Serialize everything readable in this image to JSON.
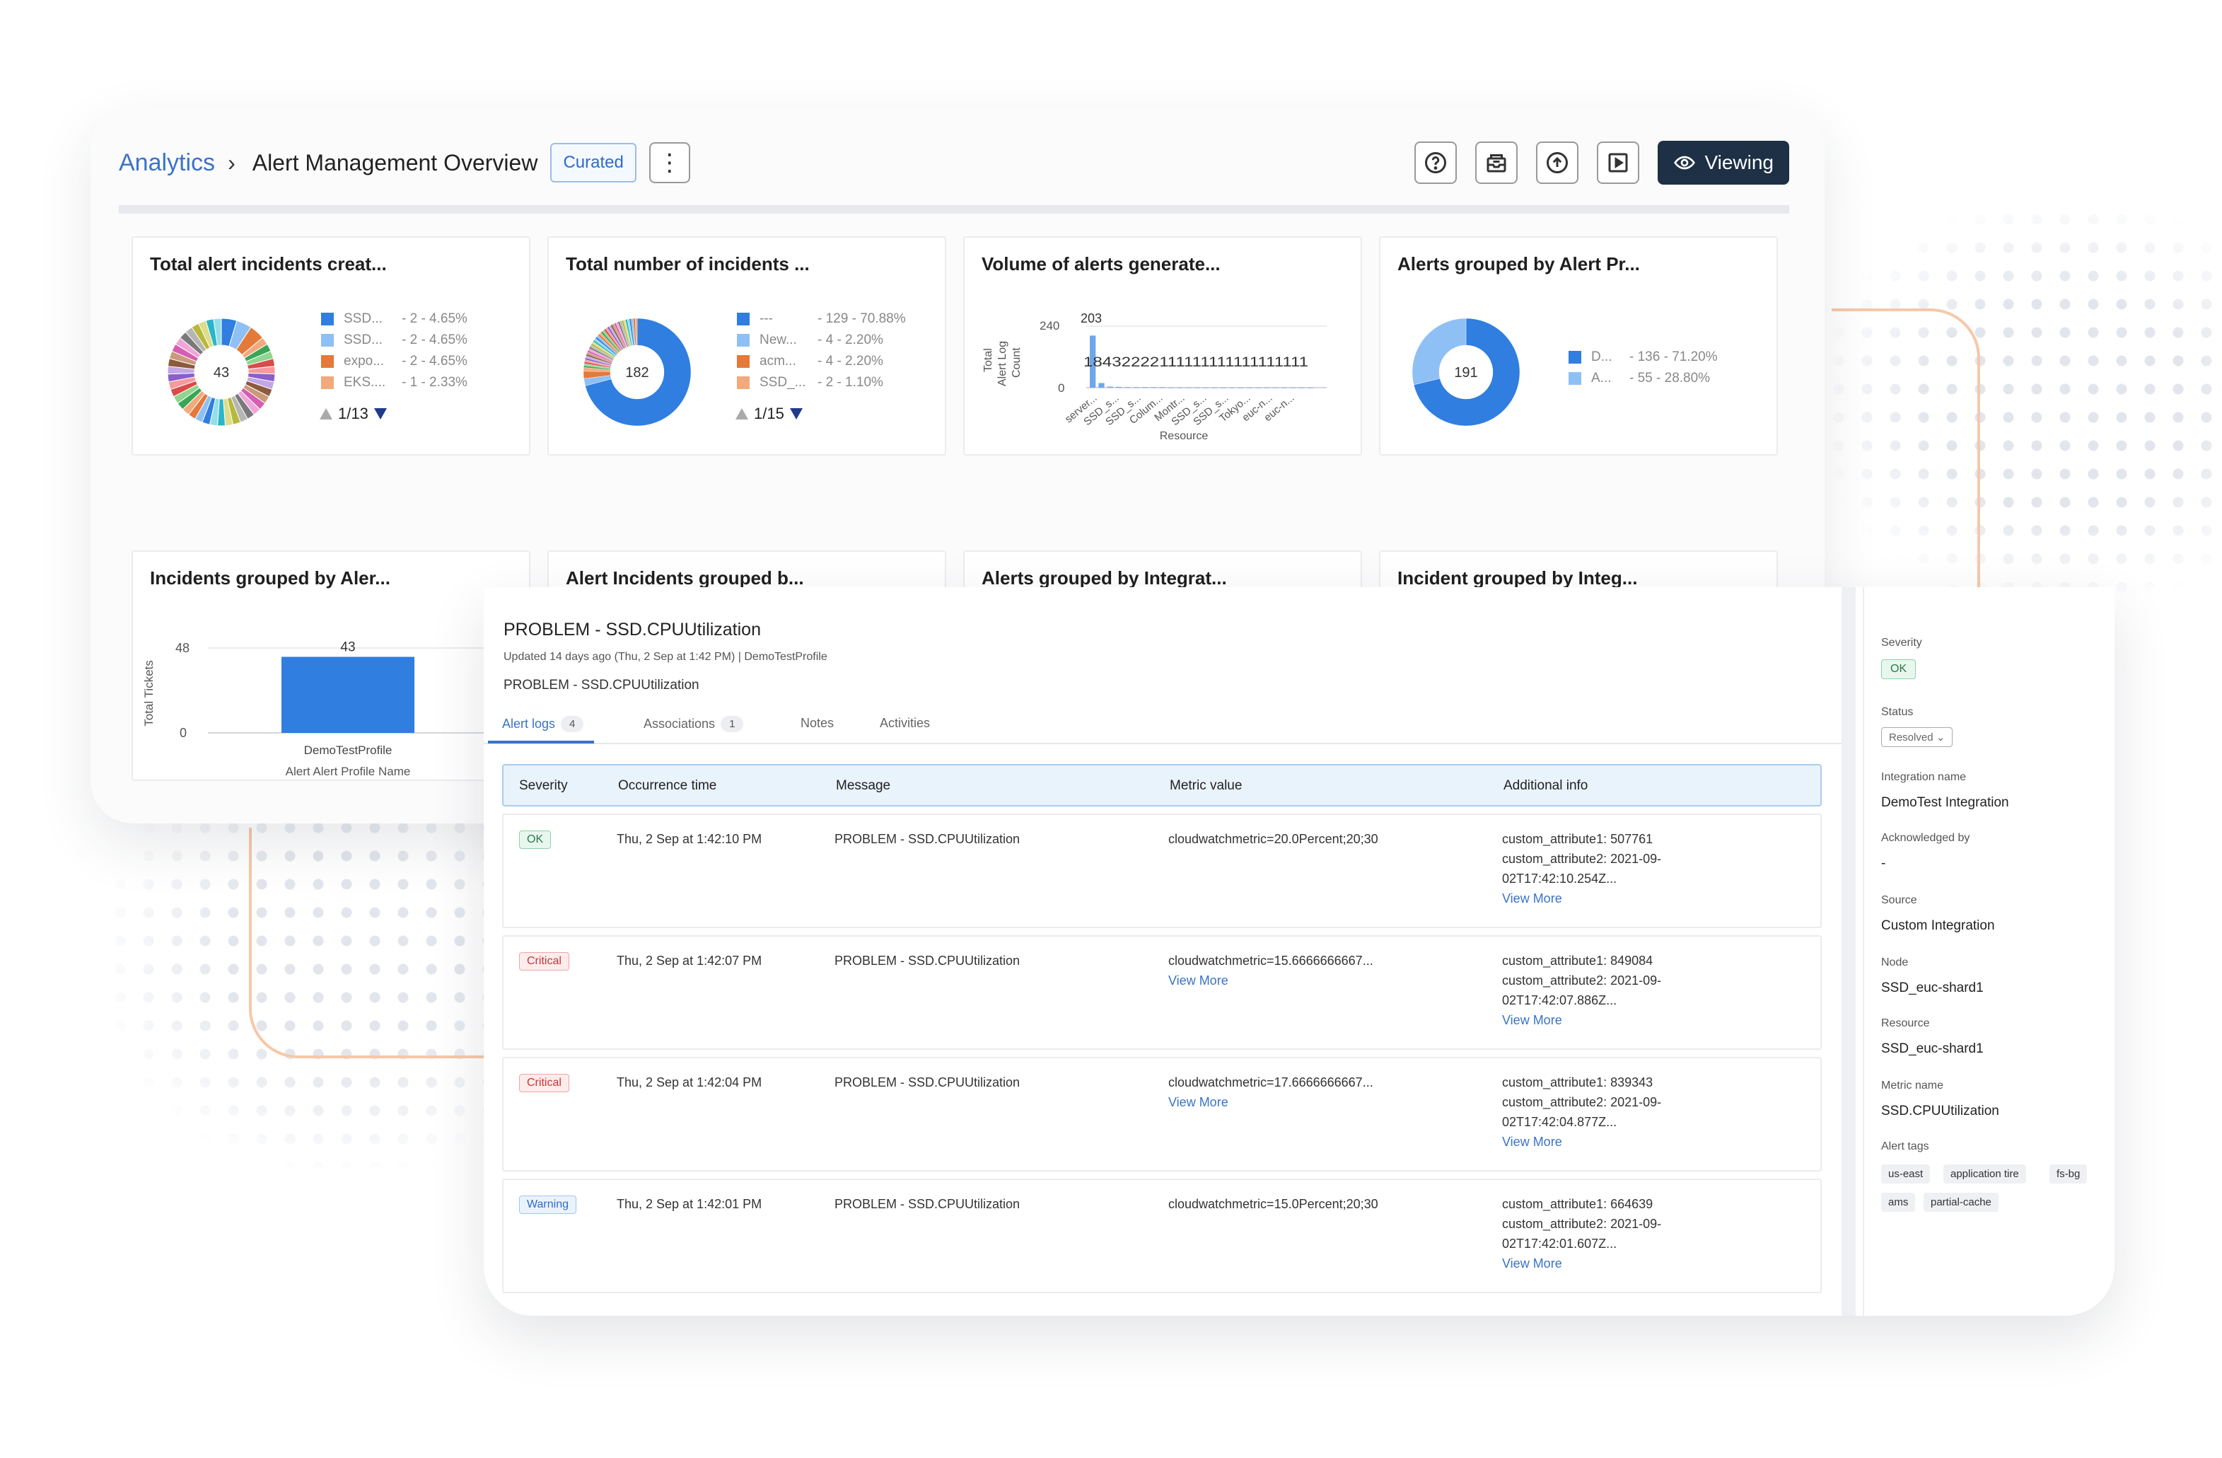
{
  "header": {
    "breadcrumb_root": "Analytics",
    "breadcrumb_sep": "›",
    "page_title": "Alert Management Overview",
    "curated_label": "Curated",
    "kebab": "⋮",
    "viewing_label": "Viewing"
  },
  "cards": {
    "c1": {
      "title": "Total alert incidents creat...",
      "center": "43",
      "legend": [
        {
          "name": "SSD...",
          "value": "- 2 - 4.65%",
          "color": "#2f7ee0"
        },
        {
          "name": "SSD...",
          "value": "- 2 - 4.65%",
          "color": "#8fc0f5"
        },
        {
          "name": "expo...",
          "value": "- 2 - 4.65%",
          "color": "#e5793a"
        },
        {
          "name": "EKS....",
          "value": "- 1 - 2.33%",
          "color": "#f2a97e"
        }
      ],
      "pager": "1/13"
    },
    "c2": {
      "title": "Total number of incidents ...",
      "center": "182",
      "legend": [
        {
          "name": "---",
          "value": "- 129 - 70.88%",
          "color": "#2f7ee0"
        },
        {
          "name": "New...",
          "value": "- 4 - 2.20%",
          "color": "#8fc0f5"
        },
        {
          "name": "acm...",
          "value": "- 4 - 2.20%",
          "color": "#e5793a"
        },
        {
          "name": "SSD_...",
          "value": "- 2 - 1.10%",
          "color": "#f2a97e"
        }
      ],
      "pager": "1/15"
    },
    "c3": {
      "title": "Volume of alerts generate...",
      "ylabel_1": "Total",
      "ylabel_2": "Alert Log",
      "ylabel_3": "Count",
      "y_top": "240",
      "y_zero": "0",
      "peak_label": "203",
      "series_labels": "18432222111111111111111111",
      "x_ticks": [
        "server...",
        "SSD_s...",
        "SSD_s...",
        "Colum...",
        "Montr...",
        "SSD_s...",
        "SSD_s...",
        "Tokyo...",
        "euc-n...",
        "euc-n..."
      ],
      "xlabel": "Resource"
    },
    "c4": {
      "title": "Alerts grouped by Alert Pr...",
      "center": "191",
      "legend": [
        {
          "name": "D...",
          "value": "- 136 - 71.20%",
          "color": "#2f7ee0"
        },
        {
          "name": "A...",
          "value": "- 55 - 28.80%",
          "color": "#8fc0f5"
        }
      ]
    },
    "c5": {
      "title": "Incidents grouped by Aler...",
      "ylabel": "Total Tickets",
      "y_top": "48",
      "y_zero": "0",
      "bar_label": "43",
      "x_tick": "DemoTestProfile",
      "xlabel": "Alert Alert Profile Name"
    },
    "c6": {
      "title": "Alert Incidents grouped b..."
    },
    "c7": {
      "title": "Alerts grouped by Integrat..."
    },
    "c8": {
      "title": "Incident grouped by Integ..."
    }
  },
  "chart_data": [
    {
      "type": "pie",
      "title": "Total alert incidents creat...",
      "total": 43,
      "labels": [
        "SSD...",
        "SSD...",
        "expo...",
        "EKS...."
      ],
      "values": [
        2,
        2,
        2,
        1
      ],
      "percent": [
        4.65,
        4.65,
        4.65,
        2.33
      ]
    },
    {
      "type": "pie",
      "title": "Total number of incidents ...",
      "total": 182,
      "labels": [
        "---",
        "New...",
        "acm...",
        "SSD_..."
      ],
      "values": [
        129,
        4,
        4,
        2
      ],
      "percent": [
        70.88,
        2.2,
        2.2,
        1.1
      ]
    },
    {
      "type": "bar",
      "title": "Volume of alerts generate...",
      "xlabel": "Resource",
      "ylabel": "Total Alert Log Count",
      "categories": [
        "server...",
        "SSD_s...",
        "SSD_s...",
        "Colum...",
        "Montr...",
        "SSD_s...",
        "SSD_s...",
        "Tokyo...",
        "euc-n...",
        "euc-n..."
      ],
      "values": [
        203,
        18,
        4,
        3,
        2,
        2,
        2,
        2,
        2,
        1,
        1,
        1,
        1,
        1,
        1,
        1,
        1,
        1,
        1,
        1,
        1,
        1,
        1,
        1,
        1,
        1
      ],
      "ylim": [
        0,
        240
      ]
    },
    {
      "type": "pie",
      "title": "Alerts grouped by Alert Pr...",
      "total": 191,
      "labels": [
        "D...",
        "A..."
      ],
      "values": [
        136,
        55
      ],
      "percent": [
        71.2,
        28.8
      ]
    },
    {
      "type": "bar",
      "title": "Incidents grouped by Aler...",
      "xlabel": "Alert Alert Profile Name",
      "ylabel": "Total Tickets",
      "categories": [
        "DemoTestProfile"
      ],
      "values": [
        43
      ],
      "ylim": [
        0,
        48
      ]
    }
  ],
  "detail": {
    "title": "PROBLEM - SSD.CPUUtilization",
    "updated": "Updated 14 days ago (Thu, 2 Sep at 1:42 PM) | DemoTestProfile",
    "subtitle": "PROBLEM - SSD.CPUUtilization",
    "tabs": [
      {
        "label": "Alert logs",
        "count": "4"
      },
      {
        "label": "Associations",
        "count": "1"
      },
      {
        "label": "Notes",
        "count": ""
      },
      {
        "label": "Activities",
        "count": ""
      }
    ],
    "columns": [
      "Severity",
      "Occurrence time",
      "Message",
      "Metric value",
      "Additional info"
    ],
    "rows": [
      {
        "severity": "OK",
        "time": "Thu, 2 Sep at 1:42:10 PM",
        "message": "PROBLEM - SSD.CPUUtilization",
        "metric": "cloudwatchmetric=20.0Percent;20;30",
        "metric_more": "",
        "info1": "custom_attribute1: 507761",
        "info2": "custom_attribute2: 2021-09-",
        "info3": "02T17:42:10.254Z...",
        "info_more": "View More"
      },
      {
        "severity": "Critical",
        "time": "Thu, 2 Sep at 1:42:07 PM",
        "message": "PROBLEM - SSD.CPUUtilization",
        "metric": "cloudwatchmetric=15.6666666667...",
        "metric_more": "View More",
        "info1": "custom_attribute1: 849084",
        "info2": "custom_attribute2: 2021-09-",
        "info3": "02T17:42:07.886Z...",
        "info_more": "View More"
      },
      {
        "severity": "Critical",
        "time": "Thu, 2 Sep at 1:42:04 PM",
        "message": "PROBLEM - SSD.CPUUtilization",
        "metric": "cloudwatchmetric=17.6666666667...",
        "metric_more": "View More",
        "info1": "custom_attribute1: 839343",
        "info2": "custom_attribute2: 2021-09-",
        "info3": "02T17:42:04.877Z...",
        "info_more": "View More"
      },
      {
        "severity": "Warning",
        "time": "Thu, 2 Sep at 1:42:01 PM",
        "message": "PROBLEM - SSD.CPUUtilization",
        "metric": "cloudwatchmetric=15.0Percent;20;30",
        "metric_more": "",
        "info1": "custom_attribute1: 664639",
        "info2": "custom_attribute2: 2021-09-",
        "info3": "02T17:42:01.607Z...",
        "info_more": "View More"
      }
    ]
  },
  "sidebar": {
    "severity_label": "Severity",
    "severity_value": "OK",
    "status_label": "Status",
    "status_value": "Resolved ⌄",
    "integration_label": "Integration name",
    "integration_value": "DemoTest Integration",
    "ack_label": "Acknowledged by",
    "ack_value": "-",
    "source_label": "Source",
    "source_value": "Custom Integration",
    "node_label": "Node",
    "node_value": "SSD_euc-shard1",
    "resource_label": "Resource",
    "resource_value": "SSD_euc-shard1",
    "metric_label": "Metric name",
    "metric_value": "SSD.CPUUtilization",
    "tags_label": "Alert tags",
    "tags": [
      "us-east",
      "application tire",
      "fs-bg",
      "ams",
      "partial-cache"
    ]
  },
  "colors": {
    "accent": "#3a73c7",
    "primary_dark": "#1d3045",
    "series_blue": "#2f7ee0",
    "series_light_blue": "#8fc0f5"
  }
}
